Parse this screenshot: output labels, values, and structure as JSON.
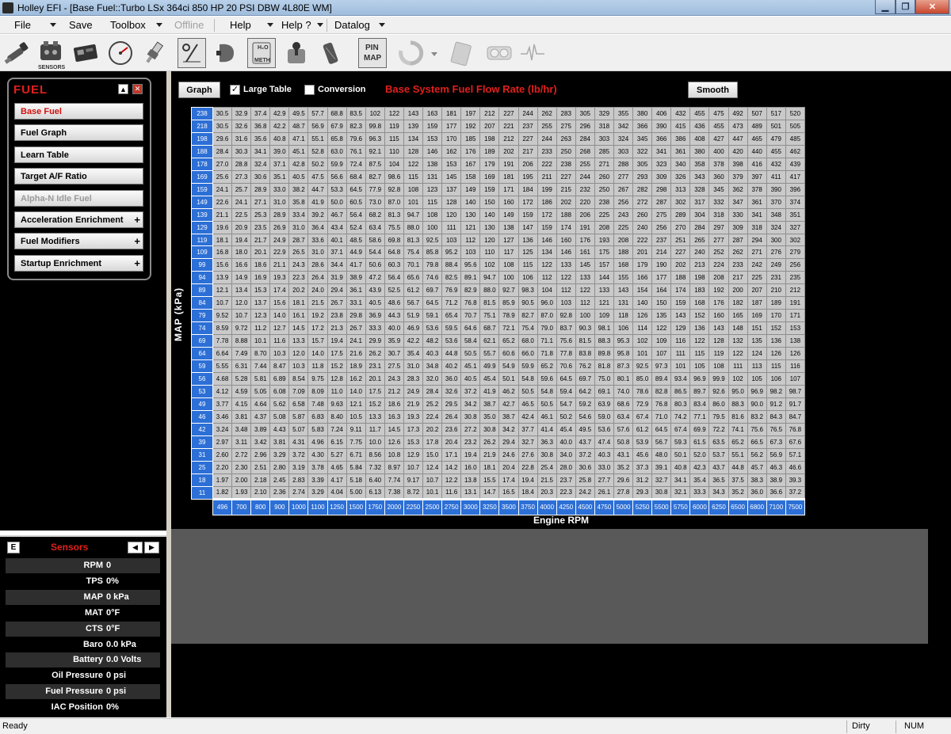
{
  "window": {
    "title": "Holley EFI - [Base Fuel::Turbo LSx 364ci 850 HP 20 PSI DBW 4L80E WM]"
  },
  "menu": {
    "file": "File",
    "save": "Save",
    "toolbox": "Toolbox",
    "offline": "Offline",
    "help": "Help",
    "help_q": "Help ?",
    "datalog": "Datalog"
  },
  "toolbar": {
    "sensors_label": "SENSORS",
    "meth_label": "METH",
    "h2o_label": "H₂O",
    "pin_label": "PIN",
    "map_label": "MAP"
  },
  "icons": [
    "injector-icon",
    "sensors-icon",
    "ecu-icon",
    "gauge-icon",
    "spark-plug-icon",
    "ratio-icon",
    "coil-icon",
    "methanol-icon",
    "shifter-icon",
    "pedal-icon",
    "pin-map-icon",
    "refresh-icon",
    "clipboard-icon",
    "gauges-icon",
    "waveform-icon"
  ],
  "fuel_panel": {
    "title": "FUEL",
    "items": [
      {
        "label": "Base Fuel",
        "selected": true
      },
      {
        "label": "Fuel Graph"
      },
      {
        "label": "Learn Table"
      },
      {
        "label": "Target A/F Ratio"
      },
      {
        "label": "Alpha-N Idle Fuel",
        "disabled": true
      },
      {
        "label": "Acceleration Enrichment",
        "expand": "+"
      },
      {
        "label": "Fuel Modifiers",
        "expand": "+"
      },
      {
        "label": "Startup Enrichment",
        "expand": "+"
      }
    ]
  },
  "sensors": {
    "title": "Sensors",
    "e_label": "E",
    "rows": [
      {
        "label": "RPM",
        "value": "0"
      },
      {
        "label": "TPS",
        "value": "0%"
      },
      {
        "label": "MAP",
        "value": "0 kPa"
      },
      {
        "label": "MAT",
        "value": "0°F"
      },
      {
        "label": "CTS",
        "value": "0°F"
      },
      {
        "label": "Baro",
        "value": "0.0 kPa"
      },
      {
        "label": "Battery",
        "value": "0.0 Volts"
      },
      {
        "label": "Oil Pressure",
        "value": "0 psi"
      },
      {
        "label": "Fuel Pressure",
        "value": "0 psi"
      },
      {
        "label": "IAC Position",
        "value": "0%"
      }
    ]
  },
  "table": {
    "graph_btn": "Graph",
    "large_table": "Large Table",
    "large_table_checked": true,
    "conversion": "Conversion",
    "conversion_checked": false,
    "title": "Base System Fuel Flow Rate (lb/hr)",
    "smooth_btn": "Smooth",
    "ylabel": "MAP (kPa)",
    "xlabel": "Engine RPM",
    "map": [
      "238",
      "218",
      "198",
      "188",
      "178",
      "169",
      "159",
      "149",
      "139",
      "129",
      "119",
      "109",
      "99",
      "94",
      "89",
      "84",
      "79",
      "74",
      "69",
      "64",
      "59",
      "56",
      "53",
      "49",
      "46",
      "42",
      "39",
      "31",
      "25",
      "18",
      "11"
    ],
    "rpm": [
      "496",
      "700",
      "800",
      "900",
      "1000",
      "1100",
      "1250",
      "1500",
      "1750",
      "2000",
      "2250",
      "2500",
      "2750",
      "3000",
      "3250",
      "3500",
      "3750",
      "4000",
      "4250",
      "4500",
      "4750",
      "5000",
      "5250",
      "5500",
      "5750",
      "6000",
      "6250",
      "6500",
      "6800",
      "7100",
      "7500"
    ],
    "rows": [
      [
        "30.5",
        "32.9",
        "37.4",
        "42.9",
        "49.5",
        "57.7",
        "68.8",
        "83.5",
        "102",
        "122",
        "143",
        "163",
        "181",
        "197",
        "212",
        "227",
        "244",
        "262",
        "283",
        "305",
        "329",
        "355",
        "380",
        "406",
        "432",
        "455",
        "475",
        "492",
        "507",
        "517",
        "520"
      ],
      [
        "30.5",
        "32.6",
        "36.8",
        "42.2",
        "48.7",
        "56.9",
        "67.9",
        "82.3",
        "99.8",
        "119",
        "139",
        "159",
        "177",
        "192",
        "207",
        "221",
        "237",
        "255",
        "275",
        "296",
        "318",
        "342",
        "366",
        "390",
        "415",
        "436",
        "455",
        "473",
        "489",
        "501",
        "505"
      ],
      [
        "29.6",
        "31.6",
        "35.6",
        "40.8",
        "47.1",
        "55.1",
        "65.8",
        "79.6",
        "96.3",
        "115",
        "134",
        "153",
        "170",
        "185",
        "198",
        "212",
        "227",
        "244",
        "263",
        "284",
        "303",
        "324",
        "345",
        "366",
        "386",
        "408",
        "427",
        "447",
        "465",
        "479",
        "485"
      ],
      [
        "28.4",
        "30.3",
        "34.1",
        "39.0",
        "45.1",
        "52.8",
        "63.0",
        "76.1",
        "92.1",
        "110",
        "128",
        "146",
        "162",
        "176",
        "189",
        "202",
        "217",
        "233",
        "250",
        "268",
        "285",
        "303",
        "322",
        "341",
        "361",
        "380",
        "400",
        "420",
        "440",
        "455",
        "462"
      ],
      [
        "27.0",
        "28.8",
        "32.4",
        "37.1",
        "42.8",
        "50.2",
        "59.9",
        "72.4",
        "87.5",
        "104",
        "122",
        "138",
        "153",
        "167",
        "179",
        "191",
        "206",
        "222",
        "238",
        "255",
        "271",
        "288",
        "305",
        "323",
        "340",
        "358",
        "378",
        "398",
        "416",
        "432",
        "439"
      ],
      [
        "25.6",
        "27.3",
        "30.6",
        "35.1",
        "40.5",
        "47.5",
        "56.6",
        "68.4",
        "82.7",
        "98.6",
        "115",
        "131",
        "145",
        "158",
        "169",
        "181",
        "195",
        "211",
        "227",
        "244",
        "260",
        "277",
        "293",
        "309",
        "326",
        "343",
        "360",
        "379",
        "397",
        "411",
        "417"
      ],
      [
        "24.1",
        "25.7",
        "28.9",
        "33.0",
        "38.2",
        "44.7",
        "53.3",
        "64.5",
        "77.9",
        "92.8",
        "108",
        "123",
        "137",
        "149",
        "159",
        "171",
        "184",
        "199",
        "215",
        "232",
        "250",
        "267",
        "282",
        "298",
        "313",
        "328",
        "345",
        "362",
        "378",
        "390",
        "396"
      ],
      [
        "22.6",
        "24.1",
        "27.1",
        "31.0",
        "35.8",
        "41.9",
        "50.0",
        "60.5",
        "73.0",
        "87.0",
        "101",
        "115",
        "128",
        "140",
        "150",
        "160",
        "172",
        "186",
        "202",
        "220",
        "238",
        "256",
        "272",
        "287",
        "302",
        "317",
        "332",
        "347",
        "361",
        "370",
        "374"
      ],
      [
        "21.1",
        "22.5",
        "25.3",
        "28.9",
        "33.4",
        "39.2",
        "46.7",
        "56.4",
        "68.2",
        "81.3",
        "94.7",
        "108",
        "120",
        "130",
        "140",
        "149",
        "159",
        "172",
        "188",
        "206",
        "225",
        "243",
        "260",
        "275",
        "289",
        "304",
        "318",
        "330",
        "341",
        "348",
        "351"
      ],
      [
        "19.6",
        "20.9",
        "23.5",
        "26.9",
        "31.0",
        "36.4",
        "43.4",
        "52.4",
        "63.4",
        "75.5",
        "88.0",
        "100",
        "111",
        "121",
        "130",
        "138",
        "147",
        "159",
        "174",
        "191",
        "208",
        "225",
        "240",
        "256",
        "270",
        "284",
        "297",
        "309",
        "318",
        "324",
        "327"
      ],
      [
        "18.1",
        "19.4",
        "21.7",
        "24.9",
        "28.7",
        "33.6",
        "40.1",
        "48.5",
        "58.6",
        "69.8",
        "81.3",
        "92.5",
        "103",
        "112",
        "120",
        "127",
        "136",
        "146",
        "160",
        "176",
        "193",
        "208",
        "222",
        "237",
        "251",
        "265",
        "277",
        "287",
        "294",
        "300",
        "302"
      ],
      [
        "16.8",
        "18.0",
        "20.1",
        "22.9",
        "26.5",
        "31.0",
        "37.1",
        "44.9",
        "54.4",
        "64.8",
        "75.4",
        "85.8",
        "95.2",
        "103",
        "110",
        "117",
        "125",
        "134",
        "146",
        "161",
        "175",
        "188",
        "201",
        "214",
        "227",
        "240",
        "252",
        "262",
        "271",
        "276",
        "279"
      ],
      [
        "15.6",
        "16.6",
        "18.6",
        "21.1",
        "24.3",
        "28.6",
        "34.4",
        "41.7",
        "50.6",
        "60.3",
        "70.1",
        "79.8",
        "88.4",
        "95.6",
        "102",
        "108",
        "115",
        "122",
        "133",
        "145",
        "157",
        "168",
        "179",
        "190",
        "202",
        "213",
        "224",
        "233",
        "242",
        "249",
        "256"
      ],
      [
        "13.9",
        "14.9",
        "16.9",
        "19.3",
        "22.3",
        "26.4",
        "31.9",
        "38.9",
        "47.2",
        "56.4",
        "65.6",
        "74.6",
        "82.5",
        "89.1",
        "94.7",
        "100",
        "106",
        "112",
        "122",
        "133",
        "144",
        "155",
        "166",
        "177",
        "188",
        "198",
        "208",
        "217",
        "225",
        "231",
        "235"
      ],
      [
        "12.1",
        "13.4",
        "15.3",
        "17.4",
        "20.2",
        "24.0",
        "29.4",
        "36.1",
        "43.9",
        "52.5",
        "61.2",
        "69.7",
        "76.9",
        "82.9",
        "88.0",
        "92.7",
        "98.3",
        "104",
        "112",
        "122",
        "133",
        "143",
        "154",
        "164",
        "174",
        "183",
        "192",
        "200",
        "207",
        "210",
        "212"
      ],
      [
        "10.7",
        "12.0",
        "13.7",
        "15.6",
        "18.1",
        "21.5",
        "26.7",
        "33.1",
        "40.5",
        "48.6",
        "56.7",
        "64.5",
        "71.2",
        "76.8",
        "81.5",
        "85.9",
        "90.5",
        "96.0",
        "103",
        "112",
        "121",
        "131",
        "140",
        "150",
        "159",
        "168",
        "176",
        "182",
        "187",
        "189",
        "191"
      ],
      [
        "9.52",
        "10.7",
        "12.3",
        "14.0",
        "16.1",
        "19.2",
        "23.8",
        "29.8",
        "36.9",
        "44.3",
        "51.9",
        "59.1",
        "65.4",
        "70.7",
        "75.1",
        "78.9",
        "82.7",
        "87.0",
        "92.8",
        "100",
        "109",
        "118",
        "126",
        "135",
        "143",
        "152",
        "160",
        "165",
        "169",
        "170",
        "171"
      ],
      [
        "8.59",
        "9.72",
        "11.2",
        "12.7",
        "14.5",
        "17.2",
        "21.3",
        "26.7",
        "33.3",
        "40.0",
        "46.9",
        "53.6",
        "59.5",
        "64.6",
        "68.7",
        "72.1",
        "75.4",
        "79.0",
        "83.7",
        "90.3",
        "98.1",
        "106",
        "114",
        "122",
        "129",
        "136",
        "143",
        "148",
        "151",
        "152",
        "153"
      ],
      [
        "7.78",
        "8.88",
        "10.1",
        "11.6",
        "13.3",
        "15.7",
        "19.4",
        "24.1",
        "29.9",
        "35.9",
        "42.2",
        "48.2",
        "53.6",
        "58.4",
        "62.1",
        "65.2",
        "68.0",
        "71.1",
        "75.6",
        "81.5",
        "88.3",
        "95.3",
        "102",
        "109",
        "116",
        "122",
        "128",
        "132",
        "135",
        "136",
        "138"
      ],
      [
        "6.64",
        "7.49",
        "8.70",
        "10.3",
        "12.0",
        "14.0",
        "17.5",
        "21.6",
        "26.2",
        "30.7",
        "35.4",
        "40.3",
        "44.8",
        "50.5",
        "55.7",
        "60.6",
        "66.0",
        "71.8",
        "77.8",
        "83.8",
        "89.8",
        "95.8",
        "101",
        "107",
        "111",
        "115",
        "119",
        "122",
        "124",
        "126",
        "126"
      ],
      [
        "5.55",
        "6.31",
        "7.44",
        "8.47",
        "10.3",
        "11.8",
        "15.2",
        "18.9",
        "23.1",
        "27.5",
        "31.0",
        "34.8",
        "40.2",
        "45.1",
        "49.9",
        "54.9",
        "59.9",
        "65.2",
        "70.6",
        "76.2",
        "81.8",
        "87.3",
        "92.5",
        "97.3",
        "101",
        "105",
        "108",
        "111",
        "113",
        "115",
        "116"
      ],
      [
        "4.68",
        "5.28",
        "5.81",
        "6.89",
        "8.54",
        "9.75",
        "12.8",
        "16.2",
        "20.1",
        "24.3",
        "28.3",
        "32.0",
        "36.0",
        "40.5",
        "45.4",
        "50.1",
        "54.8",
        "59.6",
        "64.5",
        "69.7",
        "75.0",
        "80.1",
        "85.0",
        "89.4",
        "93.4",
        "96.9",
        "99.9",
        "102",
        "105",
        "106",
        "107"
      ],
      [
        "4.12",
        "4.59",
        "5.05",
        "6.08",
        "7.09",
        "8.09",
        "11.0",
        "14.0",
        "17.5",
        "21.2",
        "24.9",
        "28.4",
        "32.6",
        "37.2",
        "41.9",
        "46.2",
        "50.5",
        "54.8",
        "59.4",
        "64.2",
        "69.1",
        "74.0",
        "78.6",
        "82.8",
        "86.5",
        "89.7",
        "92.6",
        "95.0",
        "96.9",
        "98.2",
        "98.7"
      ],
      [
        "3.77",
        "4.15",
        "4.64",
        "5.62",
        "6.58",
        "7.48",
        "9.63",
        "12.1",
        "15.2",
        "18.6",
        "21.9",
        "25.2",
        "29.5",
        "34.2",
        "38.7",
        "42.7",
        "46.5",
        "50.5",
        "54.7",
        "59.2",
        "63.9",
        "68.6",
        "72.9",
        "76.8",
        "80.3",
        "83.4",
        "86.0",
        "88.3",
        "90.0",
        "91.2",
        "91.7"
      ],
      [
        "3.46",
        "3.81",
        "4.37",
        "5.08",
        "5.87",
        "6.83",
        "8.40",
        "10.5",
        "13.3",
        "16.3",
        "19.3",
        "22.4",
        "26.4",
        "30.8",
        "35.0",
        "38.7",
        "42.4",
        "46.1",
        "50.2",
        "54.6",
        "59.0",
        "63.4",
        "67.4",
        "71.0",
        "74.2",
        "77.1",
        "79.5",
        "81.6",
        "83.2",
        "84.3",
        "84.7"
      ],
      [
        "3.24",
        "3.48",
        "3.89",
        "4.43",
        "5.07",
        "5.83",
        "7.24",
        "9.11",
        "11.7",
        "14.5",
        "17.3",
        "20.2",
        "23.6",
        "27.2",
        "30.8",
        "34.2",
        "37.7",
        "41.4",
        "45.4",
        "49.5",
        "53.6",
        "57.6",
        "61.2",
        "64.5",
        "67.4",
        "69.9",
        "72.2",
        "74.1",
        "75.6",
        "76.5",
        "76.8"
      ],
      [
        "2.97",
        "3.11",
        "3.42",
        "3.81",
        "4.31",
        "4.96",
        "6.15",
        "7.75",
        "10.0",
        "12.6",
        "15.3",
        "17.8",
        "20.4",
        "23.2",
        "26.2",
        "29.4",
        "32.7",
        "36.3",
        "40.0",
        "43.7",
        "47.4",
        "50.8",
        "53.9",
        "56.7",
        "59.3",
        "61.5",
        "63.5",
        "65.2",
        "66.5",
        "67.3",
        "67.6"
      ],
      [
        "2.60",
        "2.72",
        "2.96",
        "3.29",
        "3.72",
        "4.30",
        "5.27",
        "6.71",
        "8.56",
        "10.8",
        "12.9",
        "15.0",
        "17.1",
        "19.4",
        "21.9",
        "24.6",
        "27.6",
        "30.8",
        "34.0",
        "37.2",
        "40.3",
        "43.1",
        "45.6",
        "48.0",
        "50.1",
        "52.0",
        "53.7",
        "55.1",
        "56.2",
        "56.9",
        "57.1"
      ],
      [
        "2.20",
        "2.30",
        "2.51",
        "2.80",
        "3.19",
        "3.78",
        "4.65",
        "5.84",
        "7.32",
        "8.97",
        "10.7",
        "12.4",
        "14.2",
        "16.0",
        "18.1",
        "20.4",
        "22.8",
        "25.4",
        "28.0",
        "30.6",
        "33.0",
        "35.2",
        "37.3",
        "39.1",
        "40.8",
        "42.3",
        "43.7",
        "44.8",
        "45.7",
        "46.3",
        "46.6"
      ],
      [
        "1.97",
        "2.00",
        "2.18",
        "2.45",
        "2.83",
        "3.39",
        "4.17",
        "5.18",
        "6.40",
        "7.74",
        "9.17",
        "10.7",
        "12.2",
        "13.8",
        "15.5",
        "17.4",
        "19.4",
        "21.5",
        "23.7",
        "25.8",
        "27.7",
        "29.6",
        "31.2",
        "32.7",
        "34.1",
        "35.4",
        "36.5",
        "37.5",
        "38.3",
        "38.9",
        "39.3"
      ],
      [
        "1.82",
        "1.93",
        "2.10",
        "2.36",
        "2.74",
        "3.29",
        "4.04",
        "5.00",
        "6.13",
        "7.38",
        "8.72",
        "10.1",
        "11.6",
        "13.1",
        "14.7",
        "16.5",
        "18.4",
        "20.3",
        "22.3",
        "24.2",
        "26.1",
        "27.8",
        "29.3",
        "30.8",
        "32.1",
        "33.3",
        "34.3",
        "35.2",
        "36.0",
        "36.6",
        "37.2"
      ]
    ]
  },
  "status": {
    "ready": "Ready",
    "dirty": "Dirty",
    "num": "NUM"
  },
  "colors": {
    "accent_red": "#e0201c",
    "header_blue": "#2c6fd6",
    "cell_gray": "#c9c9c9"
  }
}
